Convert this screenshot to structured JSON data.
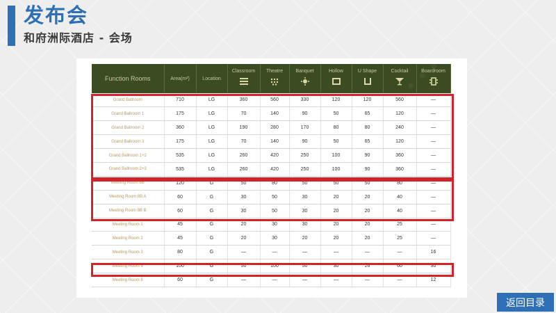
{
  "header": {
    "title": "发布会",
    "subtitle": "和府洲际酒店 - 会场"
  },
  "table": {
    "columns": [
      {
        "label": "Function Rooms",
        "icon": ""
      },
      {
        "label": "Area(m²)",
        "icon": ""
      },
      {
        "label": "Location",
        "icon": ""
      },
      {
        "label": "Classroom",
        "icon": "classroom-icon"
      },
      {
        "label": "Theatre",
        "icon": "theatre-icon"
      },
      {
        "label": "Banquet",
        "icon": "banquet-icon"
      },
      {
        "label": "Hollow",
        "icon": "hollow-icon"
      },
      {
        "label": "U Shape",
        "icon": "u-shape-icon"
      },
      {
        "label": "Cocktail",
        "icon": "cocktail-icon"
      },
      {
        "label": "Boardroom",
        "icon": "boardroom-icon"
      }
    ],
    "rows": [
      [
        "Grand Ballroom",
        "710",
        "LG",
        "360",
        "560",
        "330",
        "120",
        "120",
        "560",
        "—"
      ],
      [
        "Grand Ballroom 1",
        "175",
        "LG",
        "70",
        "140",
        "90",
        "50",
        "65",
        "120",
        "—"
      ],
      [
        "Grand Ballroom 2",
        "360",
        "LG",
        "190",
        "280",
        "170",
        "80",
        "80",
        "240",
        "—"
      ],
      [
        "Grand Ballroom 3",
        "175",
        "LG",
        "70",
        "140",
        "90",
        "50",
        "65",
        "120",
        "—"
      ],
      [
        "Grand Ballroom 1+2",
        "535",
        "LG",
        "260",
        "420",
        "250",
        "100",
        "90",
        "360",
        "—"
      ],
      [
        "Grand Ballroom 2+3",
        "535",
        "LG",
        "260",
        "420",
        "250",
        "100",
        "90",
        "360",
        "—"
      ],
      [
        "Meeting Room 8B",
        "120",
        "G",
        "50",
        "80",
        "50",
        "50",
        "50",
        "80",
        "—"
      ],
      [
        "Meeting Room 8B A",
        "60",
        "G",
        "30",
        "50",
        "30",
        "20",
        "20",
        "40",
        "—"
      ],
      [
        "Meeting Room 8B B",
        "60",
        "G",
        "30",
        "50",
        "30",
        "20",
        "20",
        "40",
        "—"
      ],
      [
        "Meeting Room 1",
        "45",
        "G",
        "20",
        "30",
        "30",
        "20",
        "20",
        "25",
        "—"
      ],
      [
        "Meeting Room 2",
        "45",
        "G",
        "20",
        "30",
        "20",
        "20",
        "20",
        "25",
        "—"
      ],
      [
        "Meeting Room 3",
        "80",
        "G",
        "—",
        "—",
        "—",
        "—",
        "—",
        "—",
        "16"
      ],
      [
        "Meeting Room 6",
        "100",
        "G",
        "50",
        "100",
        "50",
        "30",
        "26",
        "60",
        "30"
      ],
      [
        "Meeting Room 8",
        "60",
        "G",
        "—",
        "—",
        "—",
        "—",
        "—",
        "—",
        "12"
      ]
    ]
  },
  "highlight_groups": [
    {
      "rows": "1-6"
    },
    {
      "rows": "7-9"
    },
    {
      "rows": "13"
    }
  ],
  "nav": {
    "back_label": "返回目录"
  },
  "colors": {
    "accent": "#2f6fb6",
    "header_bg": "#3b4b22",
    "highlight": "#d2232a",
    "room_text": "#b59a62"
  }
}
